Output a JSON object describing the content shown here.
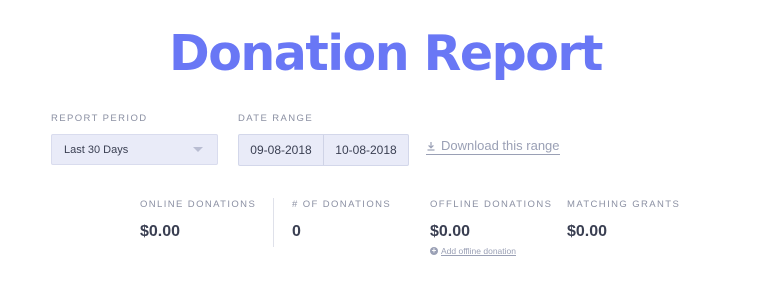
{
  "page": {
    "title": "Donation Report"
  },
  "filters": {
    "period_label": "REPORT PERIOD",
    "period_value": "Last 30 Days",
    "range_label": "DATE RANGE",
    "start_date": "09-08-2018",
    "end_date": "10-08-2018",
    "download_label": "Download this range"
  },
  "stats": [
    {
      "label": "ONLINE DONATIONS",
      "value": "$0.00"
    },
    {
      "label": "# OF DONATIONS",
      "value": "0"
    },
    {
      "label": "OFFLINE DONATIONS",
      "value": "$0.00",
      "link": "Add offline donation"
    },
    {
      "label": "MATCHING GRANTS",
      "value": "$0.00"
    }
  ],
  "icons": {
    "download": "download-icon",
    "caret": "chevron-down-icon",
    "add": "plus-circle-icon"
  },
  "colors": {
    "accent": "#6977f5",
    "muted": "#9aa0b5",
    "field_bg": "#e9ebf8"
  }
}
